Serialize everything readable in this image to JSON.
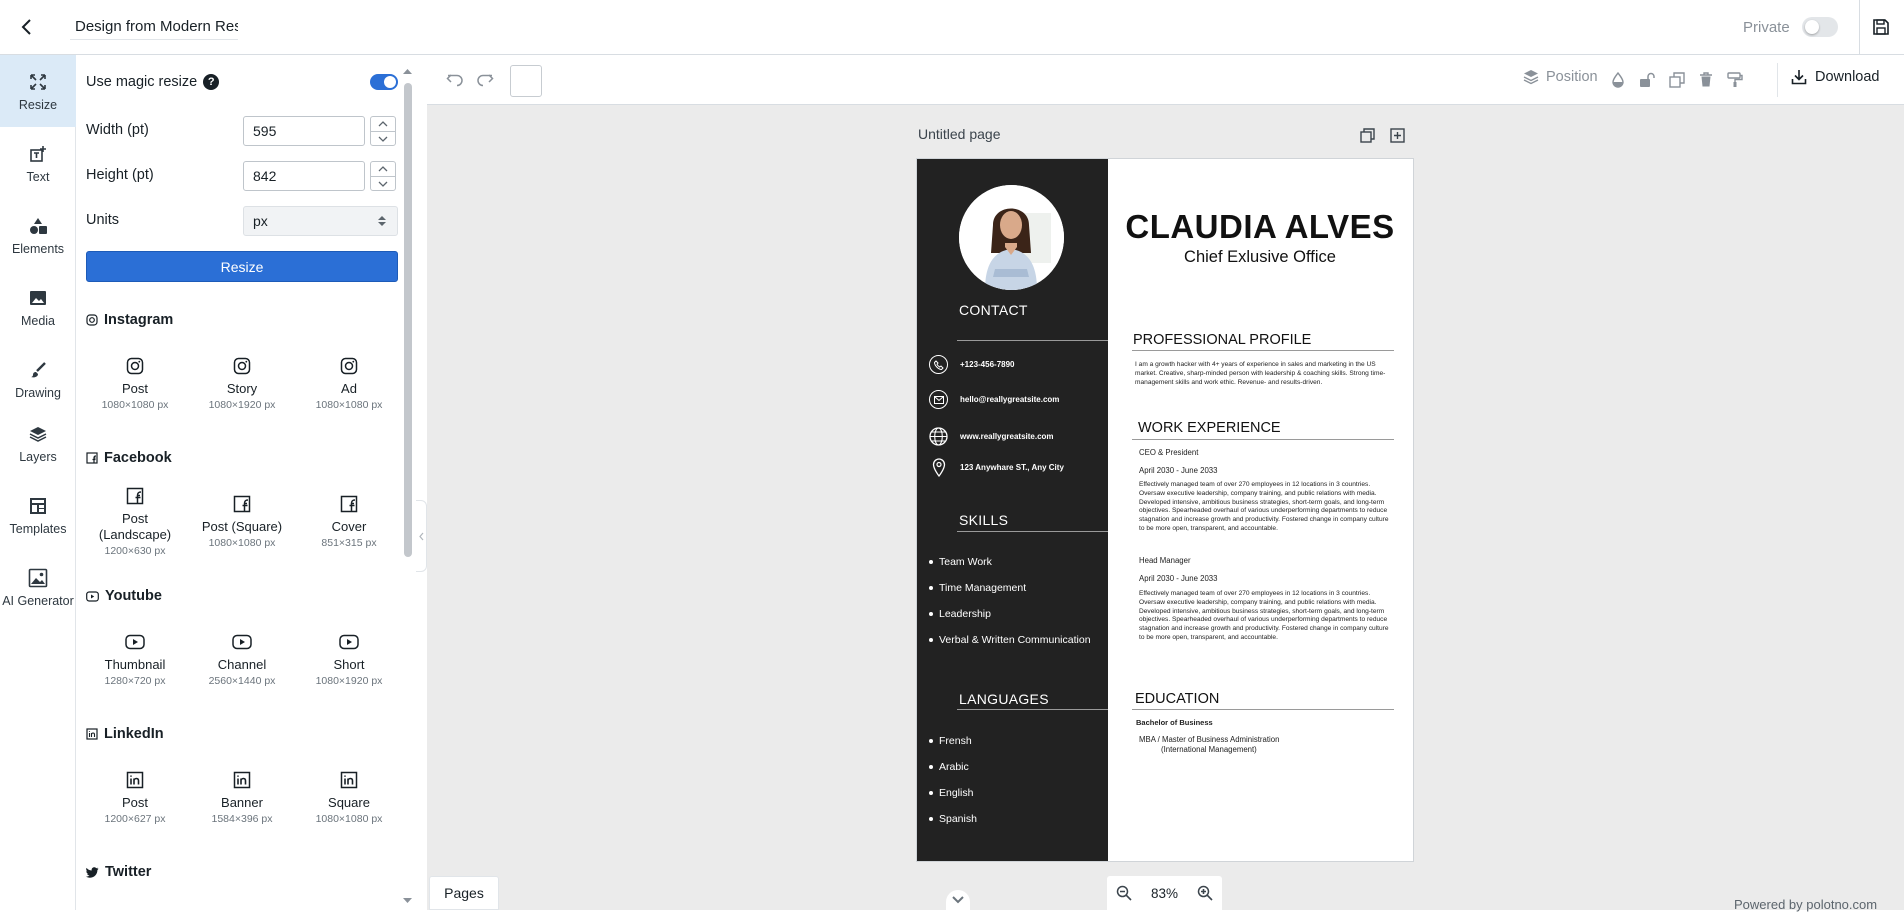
{
  "header": {
    "design_title": "Design from Modern Resu",
    "private_label": "Private",
    "private_enabled": false
  },
  "rail": {
    "items": [
      {
        "label": "Resize",
        "icon": "resize-icon",
        "active": true
      },
      {
        "label": "Text",
        "icon": "text-icon"
      },
      {
        "label": "Elements",
        "icon": "elements-icon"
      },
      {
        "label": "Media",
        "icon": "media-icon"
      },
      {
        "label": "Drawing",
        "icon": "brush-icon"
      },
      {
        "label": "Layers",
        "icon": "layers-icon"
      },
      {
        "label": "Templates",
        "icon": "templates-icon"
      },
      {
        "label": "AI Generator",
        "icon": "ai-image-icon"
      }
    ]
  },
  "resize_panel": {
    "magic_resize_label": "Use magic resize",
    "magic_resize_help": "?",
    "magic_resize_enabled": true,
    "width_label": "Width (pt)",
    "width_value": "595",
    "height_label": "Height (pt)",
    "height_value": "842",
    "units_label": "Units",
    "units_value": "px",
    "resize_button": "Resize",
    "sections": [
      {
        "title": "Instagram",
        "icon": "instagram-icon",
        "presets": [
          {
            "name": "Post",
            "size": "1080×1080 px"
          },
          {
            "name": "Story",
            "size": "1080×1920 px"
          },
          {
            "name": "Ad",
            "size": "1080×1080 px"
          }
        ]
      },
      {
        "title": "Facebook",
        "icon": "facebook-icon",
        "presets": [
          {
            "name": "Post\n(Landscape)",
            "size": "1200×630 px"
          },
          {
            "name": "Post (Square)",
            "size": "1080×1080 px"
          },
          {
            "name": "Cover",
            "size": "851×315 px"
          }
        ]
      },
      {
        "title": "Youtube",
        "icon": "youtube-icon",
        "presets": [
          {
            "name": "Thumbnail",
            "size": "1280×720 px"
          },
          {
            "name": "Channel",
            "size": "2560×1440 px"
          },
          {
            "name": "Short",
            "size": "1080×1920 px"
          }
        ]
      },
      {
        "title": "LinkedIn",
        "icon": "linkedin-icon",
        "presets": [
          {
            "name": "Post",
            "size": "1200×627 px"
          },
          {
            "name": "Banner",
            "size": "1584×396 px"
          },
          {
            "name": "Square",
            "size": "1080×1080 px"
          }
        ]
      },
      {
        "title": "Twitter",
        "icon": "twitter-icon",
        "presets": []
      }
    ]
  },
  "toolbar": {
    "position_label": "Position",
    "download_label": "Download"
  },
  "page": {
    "label": "Untitled page"
  },
  "resume": {
    "name": "CLAUDIA ALVES",
    "role": "Chief Exlusive Office",
    "contact_heading": "CONTACT",
    "phone": "+123-456-7890",
    "email": "hello@reallygreatsite.com",
    "website": "www.reallygreatsite.com",
    "address": "123 Anywhare ST., Any City",
    "skills_heading": "SKILLS",
    "skills": [
      "Team Work",
      "Time Management",
      "Leadership",
      "Verbal & Written Communication"
    ],
    "languages_heading": "LANGUAGES",
    "languages": [
      "Frensh",
      "Arabic",
      "English",
      "Spanish"
    ],
    "profile_heading": "PROFESSIONAL PROFILE",
    "profile_text": "I am a growth hacker with 4+ years of experience in sales and marketing in the US market. Creative, sharp-minded person with leadership & coaching skills. Strong time-management skills and work ethic. Revenue- and results-driven.",
    "work_heading": "WORK EXPERIENCE",
    "jobs": [
      {
        "title": "CEO & President",
        "dates": "April 2030 - June 2033",
        "description": "Effectively managed team of over 270 employees in 12 locations in 3 countries. Oversaw executive leadership, company training, and public relations with media. Developed intensive, ambitious business strategies, short-term goals, and long-term objectives. Spearheaded overhaul of various underperforming departments to reduce stagnation and increase growth and productivity. Fostered change in company culture to be more open, transparent, and accountable."
      },
      {
        "title": "Head Manager",
        "dates": "April 2030 - June 2033",
        "description": "Effectively managed team of over 270 employees in 12 locations in 3 countries. Oversaw executive leadership, company training, and public relations with media. Developed intensive, ambitious business strategies, short-term goals, and long-term objectives. Spearheaded overhaul of various underperforming departments to reduce stagnation and increase growth and productivity. Fostered change in company culture to be more open, transparent, and accountable."
      }
    ],
    "education_heading": "EDUCATION",
    "education_degree": "Bachelor of Business",
    "education_mba_line1": "MBA / Master of Business Administration",
    "education_mba_line2": "(International Management)"
  },
  "footer": {
    "pages_label": "Pages",
    "zoom_value": "83%",
    "powered_by": "Powered by polotno.com"
  },
  "colors": {
    "accent": "#2b6fd6",
    "resume_sidebar": "#222222",
    "workspace": "#ebebeb",
    "rail_active": "#dbeaf7"
  }
}
